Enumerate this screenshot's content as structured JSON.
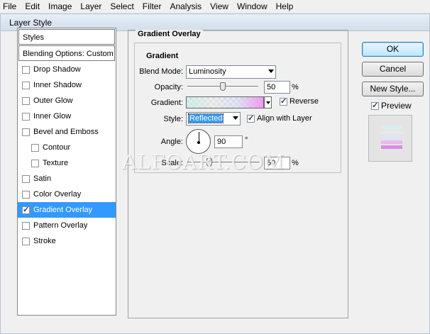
{
  "menu": [
    "File",
    "Edit",
    "Image",
    "Layer",
    "Select",
    "Filter",
    "Analysis",
    "View",
    "Window",
    "Help"
  ],
  "dialog": {
    "title": "Layer Style"
  },
  "styles_list": {
    "header": "Styles",
    "blending": "Blending Options: Custom",
    "items": [
      {
        "label": "Drop Shadow",
        "checked": false,
        "sub": false
      },
      {
        "label": "Inner Shadow",
        "checked": false,
        "sub": false
      },
      {
        "label": "Outer Glow",
        "checked": false,
        "sub": false
      },
      {
        "label": "Inner Glow",
        "checked": false,
        "sub": false
      },
      {
        "label": "Bevel and Emboss",
        "checked": false,
        "sub": false
      },
      {
        "label": "Contour",
        "checked": false,
        "sub": true
      },
      {
        "label": "Texture",
        "checked": false,
        "sub": true
      },
      {
        "label": "Satin",
        "checked": false,
        "sub": false
      },
      {
        "label": "Color Overlay",
        "checked": false,
        "sub": false
      },
      {
        "label": "Gradient Overlay",
        "checked": true,
        "sub": false,
        "selected": true
      },
      {
        "label": "Pattern Overlay",
        "checked": false,
        "sub": false
      },
      {
        "label": "Stroke",
        "checked": false,
        "sub": false
      }
    ]
  },
  "panel": {
    "title": "Gradient Overlay",
    "group_title": "Gradient",
    "blend_mode_label": "Blend Mode:",
    "blend_mode_value": "Luminosity",
    "opacity_label": "Opacity:",
    "opacity_value": "50",
    "opacity_fraction": 0.5,
    "percent": "%",
    "gradient_label": "Gradient:",
    "reverse_label": "Reverse",
    "reverse_checked": true,
    "style_label": "Style:",
    "style_value": "Reflected",
    "align_label": "Align with Layer",
    "align_checked": true,
    "angle_label": "Angle:",
    "angle_value": "90",
    "degree": "°",
    "scale_label": "Scale:",
    "scale_value": "50",
    "scale_fraction": 0.5
  },
  "buttons": {
    "ok": "OK",
    "cancel": "Cancel",
    "new_style": "New Style..."
  },
  "preview": {
    "label": "Preview",
    "checked": true
  },
  "watermark": "ALFOART.COM"
}
